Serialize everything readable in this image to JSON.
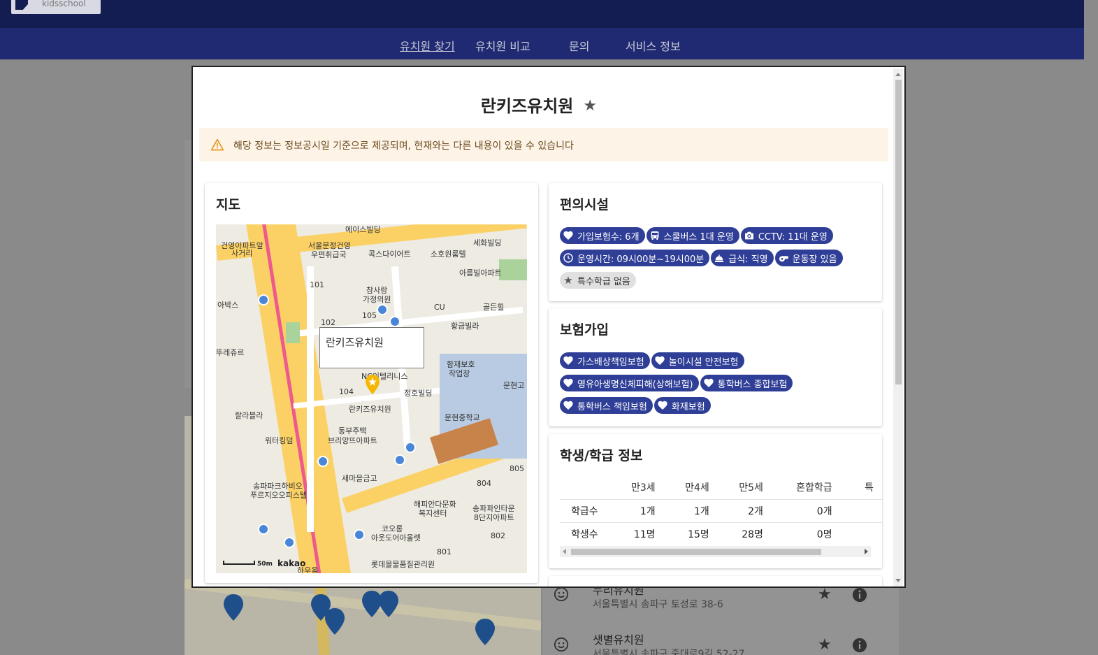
{
  "app": {
    "logo_text": "kidsschool",
    "nav": [
      "유치원 찾기",
      "유치원 비교",
      "문의",
      "서비스 정보"
    ]
  },
  "background_list": [
    {
      "name": "누리유치원",
      "address": "서울특별시 송파구 토성로 38-6"
    },
    {
      "name": "샛별유치원",
      "address": "서울특별시 송파구 중대로9길 52-27"
    }
  ],
  "modal": {
    "title": "란키즈유치원",
    "alert": "해당 정보는 정보공시일 기준으로 제공되며, 현재와는 다른 내용이 있을 수 있습니다",
    "map_section": {
      "title": "지도",
      "infobox": "란키즈유치원",
      "scale": "50m",
      "brand": "kakao",
      "labels": [
        "에이스빌딩",
        "서울문정건영",
        "우편취급국",
        "건영아파트앞",
        "사거리",
        "세화빌딩",
        "콕스다이어트",
        "소호원룸텔",
        "아름빌아파트",
        "참사랑",
        "가정의원",
        "101",
        "CU",
        "골든힐",
        "황금빌라",
        "105",
        "102",
        "건영아파트",
        "아박스",
        "뚜레쥬르",
        "함재보호",
        "작업장",
        "정호빌딩",
        "문현고",
        "란키즈유치원",
        "104",
        "문현중학교",
        "랄라블라",
        "동부주택",
        "브리앙뜨아파트",
        "워터킹덤",
        "새마을금고",
        "송파파크하비오",
        "푸르지오오피스텔",
        "해피안다문화",
        "복지센터",
        "송파파인타운",
        "8단지아파트",
        "코오롱",
        "아웃도어아울렛",
        "805",
        "804",
        "802",
        "801",
        "하우올",
        "NC인텔리니스",
        "롯데몰물품질관리원"
      ]
    },
    "facilities": {
      "title": "편의시설",
      "chips": [
        {
          "icon": "heart-icon",
          "label": "가입보험수: 6개",
          "style": "blue"
        },
        {
          "icon": "bus-icon",
          "label": "스쿨버스 1대 운영",
          "style": "blue"
        },
        {
          "icon": "camera-icon",
          "label": "CCTV: 11대 운영",
          "style": "blue"
        },
        {
          "icon": "clock-icon",
          "label": "운영시간: 09시00분~19시00분",
          "style": "blue"
        },
        {
          "icon": "meal-icon",
          "label": "급식: 직영",
          "style": "blue"
        },
        {
          "icon": "whistle-icon",
          "label": "운동장 있음",
          "style": "blue"
        },
        {
          "icon": "star-icon",
          "label": "특수학급 없음",
          "style": "gray"
        }
      ]
    },
    "insurance": {
      "title": "보험가입",
      "chips": [
        "가스배상책임보험",
        "놀이시설 안전보험",
        "영유아생명신체피해(상해보험)",
        "통학버스 종합보험",
        "통학버스 책임보험",
        "화재보험"
      ]
    },
    "students": {
      "title": "학생/학급 정보",
      "columns": [
        "",
        "만3세",
        "만4세",
        "만5세",
        "혼합학급",
        "특"
      ],
      "rows": [
        [
          "학급수",
          "1개",
          "1개",
          "2개",
          "0개",
          ""
        ],
        [
          "학생수",
          "11명",
          "15명",
          "28명",
          "0명",
          ""
        ]
      ]
    }
  },
  "colors": {
    "header": "#141d52",
    "nav": "#1f2a72",
    "chip": "#2f3e96",
    "alert_bg": "#fdf3e7"
  }
}
